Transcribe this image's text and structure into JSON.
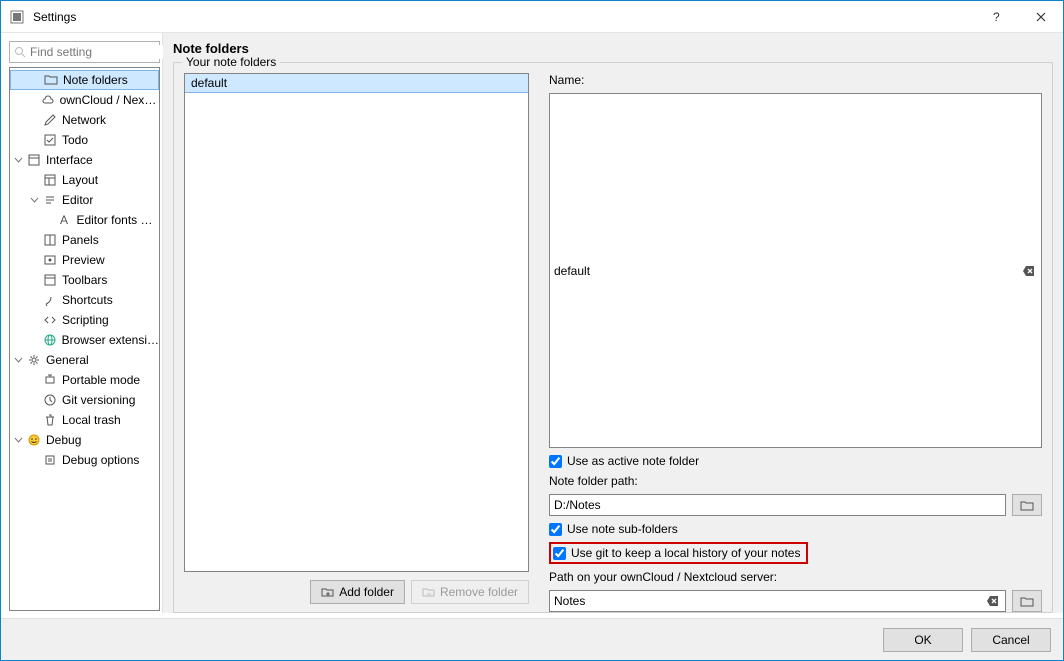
{
  "window": {
    "title": "Settings"
  },
  "sidebar": {
    "search_placeholder": "Find setting",
    "items": [
      {
        "id": "note-folders",
        "label": "Note folders",
        "icon": "folder",
        "level": 1,
        "selected": true
      },
      {
        "id": "owncloud",
        "label": "ownCloud / Nextcl…",
        "icon": "cloud",
        "level": 1
      },
      {
        "id": "network",
        "label": "Network",
        "icon": "pencil",
        "level": 1
      },
      {
        "id": "todo",
        "label": "Todo",
        "icon": "check-square",
        "level": 1
      },
      {
        "id": "interface",
        "label": "Interface",
        "icon": "window",
        "level": 0,
        "expander": "v"
      },
      {
        "id": "layout",
        "label": "Layout",
        "icon": "layout",
        "level": 1
      },
      {
        "id": "editor",
        "label": "Editor",
        "icon": "editor",
        "level": 1,
        "expander": "v"
      },
      {
        "id": "editor-fonts",
        "label": "Editor fonts & …",
        "icon": "font",
        "level": 2
      },
      {
        "id": "panels",
        "label": "Panels",
        "icon": "panels",
        "level": 1
      },
      {
        "id": "preview",
        "label": "Preview",
        "icon": "preview",
        "level": 1
      },
      {
        "id": "toolbars",
        "label": "Toolbars",
        "icon": "toolbar",
        "level": 1
      },
      {
        "id": "shortcuts",
        "label": "Shortcuts",
        "icon": "shortcuts",
        "level": 1
      },
      {
        "id": "scripting",
        "label": "Scripting",
        "icon": "scripting",
        "level": 1
      },
      {
        "id": "browser-ext",
        "label": "Browser extension",
        "icon": "globe",
        "level": 1
      },
      {
        "id": "general",
        "label": "General",
        "icon": "gear",
        "level": 0,
        "expander": "v"
      },
      {
        "id": "portable",
        "label": "Portable mode",
        "icon": "portable",
        "level": 1
      },
      {
        "id": "git",
        "label": "Git versioning",
        "icon": "clock",
        "level": 1
      },
      {
        "id": "trash",
        "label": "Local trash",
        "icon": "trash",
        "level": 1
      },
      {
        "id": "debug",
        "label": "Debug",
        "icon": "smile",
        "level": 0,
        "expander": "v"
      },
      {
        "id": "debug-opts",
        "label": "Debug options",
        "icon": "debug",
        "level": 1
      }
    ]
  },
  "panel": {
    "heading": "Note folders",
    "group_title": "Your note folders",
    "list": [
      {
        "label": "default",
        "selected": true
      }
    ],
    "add_folder_label": "Add folder",
    "remove_folder_label": "Remove folder",
    "form": {
      "name_label": "Name:",
      "name_value": "default",
      "active_label": "Use as active note folder",
      "active_checked": true,
      "path_label": "Note folder path:",
      "path_value": "D:/Notes",
      "subfolders_label": "Use note sub-folders",
      "subfolders_checked": true,
      "git_label": "Use git to keep a local history of your notes",
      "git_checked": true,
      "server_path_label": "Path on your ownCloud / Nextcloud server:",
      "server_path_value": "Notes"
    }
  },
  "footer": {
    "ok": "OK",
    "cancel": "Cancel"
  }
}
